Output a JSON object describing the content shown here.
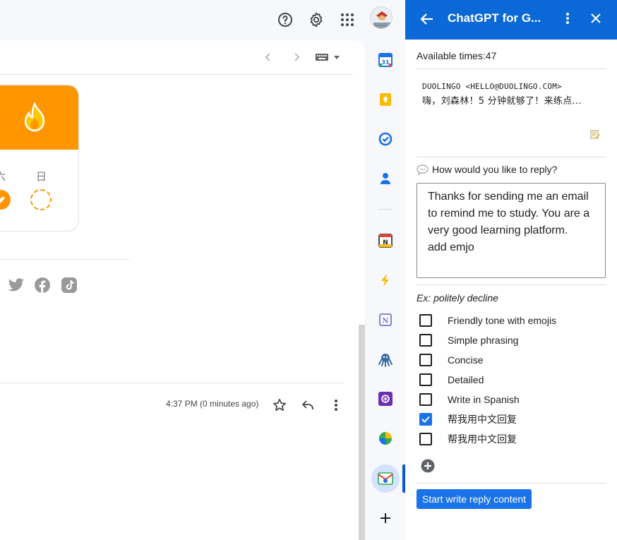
{
  "panel": {
    "title": "ChatGPT for G...",
    "available_times": "Available times:47",
    "email": {
      "sender": "DUOLINGO <HELLO@DUOLINGO.COM>",
      "snippet": "嗨，刘森林！5 分钟就够了！来练点..."
    },
    "reply_prompt": "How would you like to reply?",
    "reply_text": "Thanks for sending me an email to remind me to study. You are a very good learning platform.\nadd emjo",
    "example": "Ex: politely decline",
    "options": [
      {
        "label": "Friendly tone with emojis",
        "checked": false
      },
      {
        "label": "Simple phrasing",
        "checked": false
      },
      {
        "label": "Concise",
        "checked": false
      },
      {
        "label": "Detailed",
        "checked": false
      },
      {
        "label": "Write in Spanish",
        "checked": false
      },
      {
        "label": "帮我用中文回复",
        "checked": true
      },
      {
        "label": "帮我用中文回复",
        "checked": false
      }
    ],
    "start_button": "Start write reply content",
    "header_color": "#0b68d7"
  },
  "mail": {
    "streak_days": [
      "六",
      "日"
    ],
    "timestamp": "4:37 PM (0 minutes ago)",
    "accent_color": "#ff9600"
  },
  "topbar": {
    "icons": [
      "help-icon",
      "settings-icon",
      "apps-grid-icon",
      "avatar"
    ]
  },
  "rail": {
    "icons": [
      "calendar-icon",
      "keep-icon",
      "tasks-icon",
      "contacts-icon",
      "notion-calendar-icon",
      "lightning-icon",
      "notion-icon",
      "octopus-icon",
      "chatgpt-icon",
      "pie-chart-icon",
      "chatgpt-for-gmail-icon",
      "add-icon"
    ]
  }
}
